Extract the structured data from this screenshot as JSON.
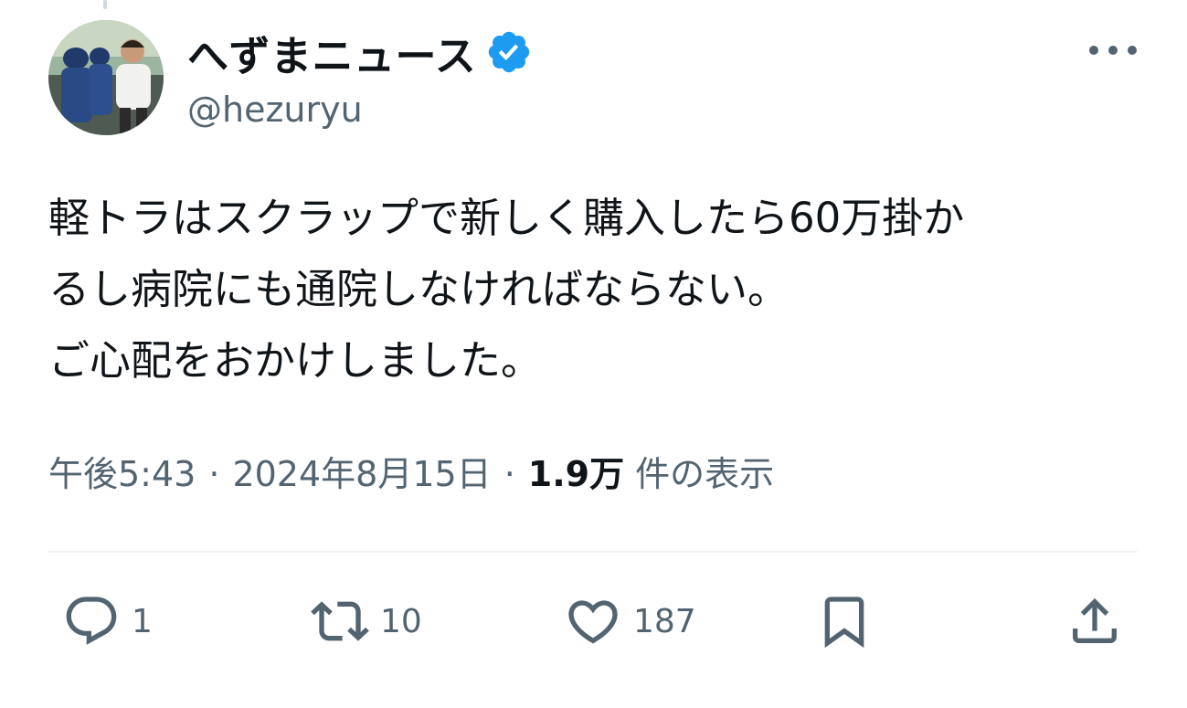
{
  "tweet": {
    "author": {
      "display_name": "へずまニュース",
      "handle": "@hezuryu",
      "verified": true,
      "avatar_icon": "profile-photo-avatar"
    },
    "text_lines": [
      "軽トラはスクラップで新しく購入したら60万掛か",
      "るし病院にも通院しなければならない。",
      "ご心配をおかけしました。"
    ],
    "meta": {
      "time": "午後5:43",
      "separator": "·",
      "date": "2024年8月15日",
      "views_count": "1.9万",
      "views_label": "件の表示"
    },
    "actions": {
      "reply_count": "1",
      "retweet_count": "10",
      "like_count": "187"
    }
  },
  "colors": {
    "verified_blue": "#1d9bf0",
    "secondary_text": "#536471",
    "primary_text": "#0f1419",
    "divider": "#eff3f4"
  },
  "icons": {
    "more": "more-horizontal-icon",
    "reply": "reply-icon",
    "retweet": "retweet-icon",
    "like": "heart-icon",
    "bookmark": "bookmark-icon",
    "share": "share-icon"
  }
}
